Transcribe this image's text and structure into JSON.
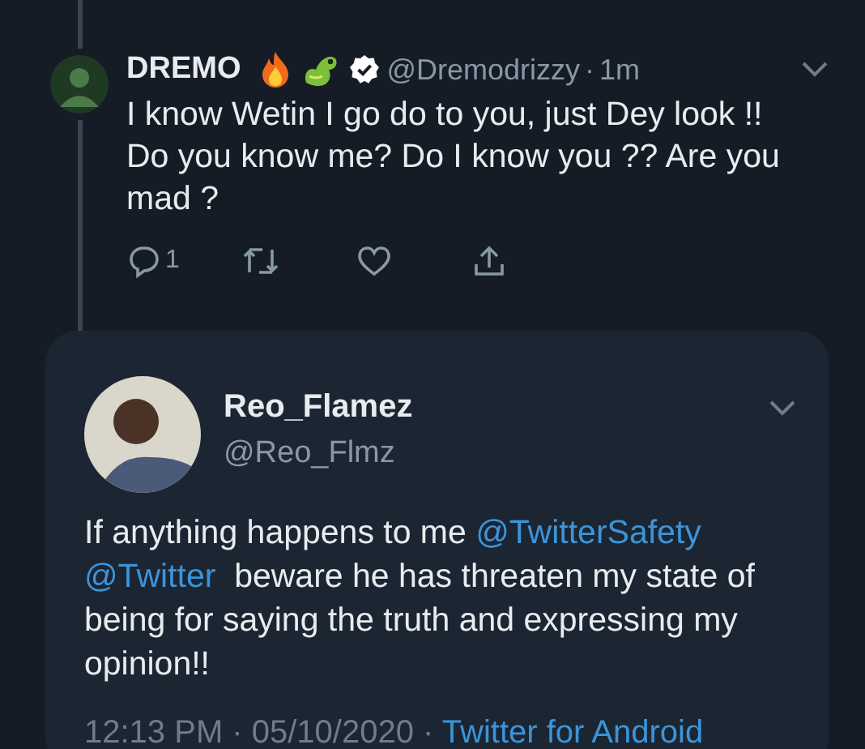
{
  "tweet": {
    "name": "DREMO",
    "handle": "@Dremodrizzy",
    "separator": "·",
    "time": "1m",
    "verified": true,
    "text": "I know Wetin I go do to you, just Dey look !! Do you know me? Do I know you ?? Are you mad ?",
    "actions": [
      {
        "kind": "reply",
        "count": "1"
      },
      {
        "kind": "retweet"
      },
      {
        "kind": "like"
      },
      {
        "kind": "share"
      }
    ]
  },
  "quoted": {
    "name": "Reo_Flamez",
    "handle": "@Reo_Flmz",
    "text": [
      {
        "kind": "text",
        "text": "If anything happens to me "
      },
      {
        "kind": "mention",
        "text": "@TwitterSafety"
      },
      {
        "kind": "mention",
        "text": "@Twitter"
      },
      {
        "kind": "text",
        "text": "  beware he has threaten my state of being for saying the truth and expressing my opinion!!"
      }
    ],
    "timestamp": "12:13 PM · 05/10/2020 · ",
    "source": "Twitter for Android"
  }
}
